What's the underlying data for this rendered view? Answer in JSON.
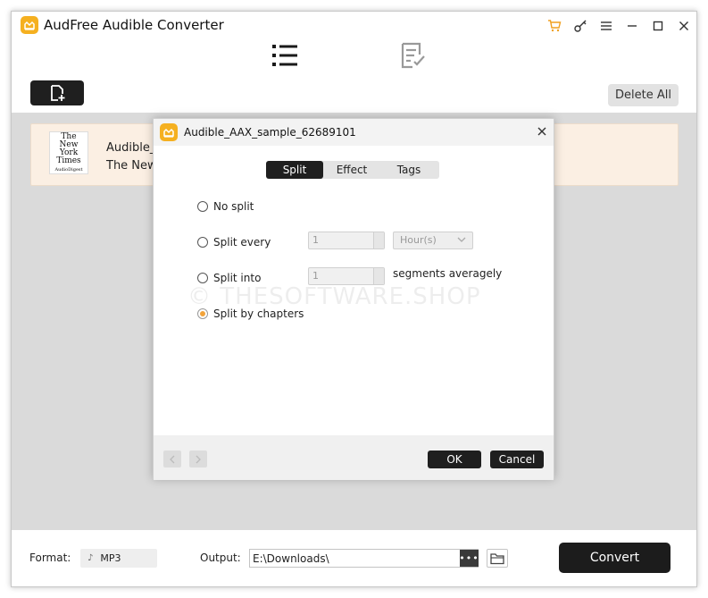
{
  "app": {
    "title": "AudFree Audible Converter",
    "accent_color": "#f5b020",
    "titlebar_icons": [
      "cart-icon",
      "key-icon",
      "menu-icon",
      "minimize-icon",
      "maximize-icon",
      "close-icon"
    ]
  },
  "main_tabs": [
    {
      "name": "list-tab",
      "icon": "list-icon",
      "active": true
    },
    {
      "name": "history-tab",
      "icon": "converted-list-icon",
      "active": false
    }
  ],
  "toolbar": {
    "add_icon": "add-file-icon",
    "delete_all_label": "Delete All"
  },
  "file_list": [
    {
      "cover_text": [
        "The",
        "New York",
        "Times"
      ],
      "cover_sub": "AudioDigest",
      "name": "Audible_A",
      "subtitle": "The New"
    }
  ],
  "dialog": {
    "title": "Audible_AAX_sample_62689101",
    "tabs": [
      {
        "label": "Split",
        "active": true
      },
      {
        "label": "Effect",
        "active": false
      },
      {
        "label": "Tags",
        "active": false
      }
    ],
    "options": {
      "no_split": {
        "label": "No split",
        "checked": false
      },
      "split_every": {
        "label": "Split every",
        "checked": false,
        "value": "1",
        "unit": "Hour(s)"
      },
      "split_into": {
        "label": "Split into",
        "checked": false,
        "value": "1",
        "suffix": "segments averagely"
      },
      "split_chapters": {
        "label": "Split by chapters",
        "checked": true
      }
    },
    "watermark": "© THESOFTWARE.SHOP",
    "ok_label": "OK",
    "cancel_label": "Cancel"
  },
  "bottom": {
    "format_label": "Format:",
    "format_value": "MP3",
    "format_note": "♪",
    "output_label": "Output:",
    "output_path": "E:\\Downloads\\",
    "browse_label": "•••",
    "convert_label": "Convert"
  }
}
